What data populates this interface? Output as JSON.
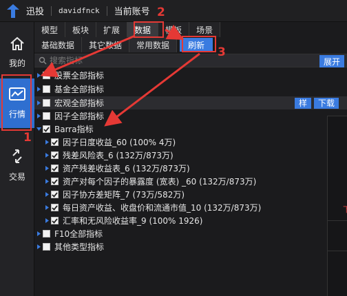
{
  "titlebar": {
    "brand": "迅投",
    "username": "davidfnck",
    "account": "当前账号"
  },
  "leftnav": [
    {
      "label": "我的",
      "icon": "home-icon"
    },
    {
      "label": "行情",
      "icon": "market-chart-icon"
    },
    {
      "label": "交易",
      "icon": "trade-arrows-icon"
    }
  ],
  "tabs": [
    "模型",
    "板块",
    "扩展",
    "数据",
    "模板",
    "场景"
  ],
  "active_tab": "数据",
  "subtabs": [
    "基础数据",
    "其它数据",
    "常用数据"
  ],
  "refresh_label": "刷新",
  "search": {
    "placeholder": "搜索指标"
  },
  "expand_label": "展开",
  "tree": [
    {
      "label": "股票全部指标"
    },
    {
      "label": "基金全部指标"
    },
    {
      "label": "宏观全部指标"
    },
    {
      "label": "因子全部指标"
    },
    {
      "label": "Barra指标"
    },
    {
      "label": "因子日度收益_60 (100% 4万)"
    },
    {
      "label": "残差风险表_6 (132万/873万)"
    },
    {
      "label": "资产残差收益表_6 (132万/873万)"
    },
    {
      "label": "资产对每个因子的暴露度 (宽表) _60 (132万/873万)"
    },
    {
      "label": "因子协方差矩阵_7 (73万/582万)"
    },
    {
      "label": "每日资产收益、收盘价和流通市值_10 (132万/873万)"
    },
    {
      "label": "汇率和无风险收益率_9 (100% 1926)"
    },
    {
      "label": "F10全部指标"
    },
    {
      "label": "其他类型指标"
    }
  ],
  "row_buttons": {
    "sample": "样",
    "download": "下载"
  },
  "right_panel_glyph": "下",
  "annotations": [
    "1",
    "2",
    "3"
  ],
  "colors": {
    "accent": "#3a7be0",
    "annotation": "#e53935",
    "background": "#1b1b1d"
  }
}
